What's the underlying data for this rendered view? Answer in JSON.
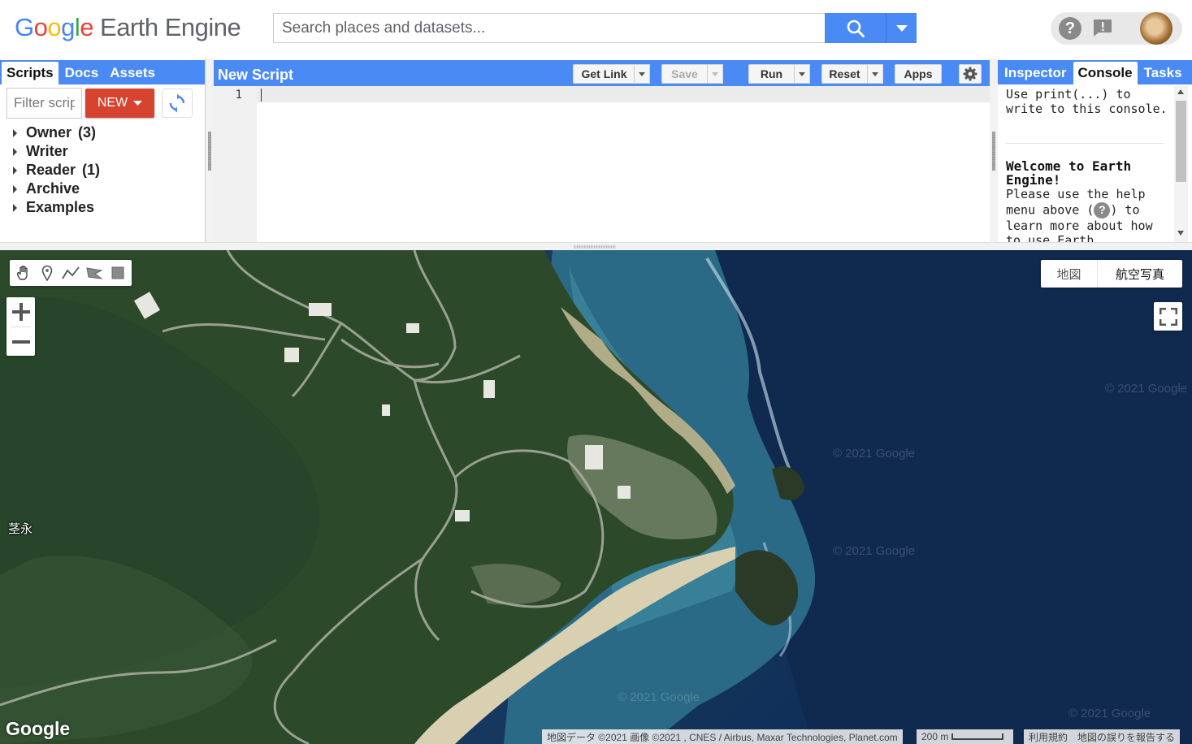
{
  "header": {
    "logo_google": [
      "G",
      "o",
      "o",
      "g",
      "l",
      "e"
    ],
    "logo_product": "Earth Engine",
    "search_placeholder": "Search places and datasets..."
  },
  "left_panel": {
    "tabs": [
      {
        "label": "Scripts",
        "active": true
      },
      {
        "label": "Docs",
        "active": false
      },
      {
        "label": "Assets",
        "active": false
      }
    ],
    "filter_placeholder": "Filter scripts...",
    "new_button": "NEW",
    "tree": [
      {
        "label": "Owner",
        "count": "(3)"
      },
      {
        "label": "Writer",
        "count": ""
      },
      {
        "label": "Reader",
        "count": "(1)"
      },
      {
        "label": "Archive",
        "count": ""
      },
      {
        "label": "Examples",
        "count": ""
      }
    ]
  },
  "editor": {
    "title": "New Script",
    "buttons": {
      "get_link": "Get Link",
      "save": "Save",
      "run": "Run",
      "reset": "Reset",
      "apps": "Apps"
    },
    "line_numbers": [
      "1"
    ]
  },
  "right_panel": {
    "tabs": [
      {
        "label": "Inspector",
        "active": false
      },
      {
        "label": "Console",
        "active": true
      },
      {
        "label": "Tasks",
        "active": false
      }
    ],
    "console_hint": "Use print(...) to write to this console.",
    "welcome_title": "Welcome to Earth Engine!",
    "help_before": "Please use the help menu above (",
    "help_after": ") to learn more about how to use Earth"
  },
  "map": {
    "map_type": {
      "map": "地図",
      "satellite": "航空写真"
    },
    "place_label": "茎永",
    "watermark": "© 2021 Google",
    "google_logo": "Google",
    "attribution": "地図データ ©2021 画像 ©2021 , CNES / Airbus, Maxar Technologies, Planet.com",
    "scale_label": "200 m",
    "terms": "利用規約",
    "report": "地図の誤りを報告する"
  },
  "colors": {
    "accent_blue": "#4a8af4",
    "new_button_red": "#d6432f",
    "forest": "#2c4a2a",
    "ocean": "#17395f"
  },
  "icons": [
    "search-icon",
    "dropdown-arrow-icon",
    "help-icon",
    "feedback-icon",
    "refresh-icon",
    "gear-icon",
    "hand-icon",
    "marker-icon",
    "line-icon",
    "polygon-icon",
    "rectangle-icon",
    "zoom-in-icon",
    "zoom-out-icon",
    "fullscreen-icon"
  ]
}
